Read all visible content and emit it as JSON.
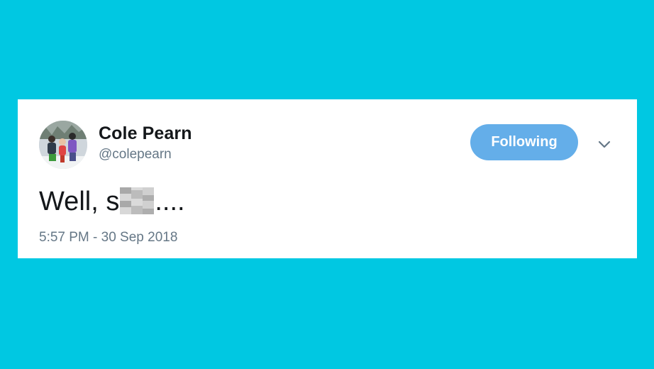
{
  "colors": {
    "page_background": "#00c8e2",
    "card_background": "#ffffff",
    "follow_button": "#64aee9",
    "secondary_text": "#657786",
    "primary_text": "#14171a"
  },
  "tweet": {
    "author_name": "Cole Pearn",
    "author_handle": "@colepearn",
    "follow_label": "Following",
    "menu_icon": "chevron-down-icon",
    "text_prefix": "Well, s",
    "text_suffix": "....",
    "timestamp": "5:57 PM - 30 Sep 2018"
  }
}
